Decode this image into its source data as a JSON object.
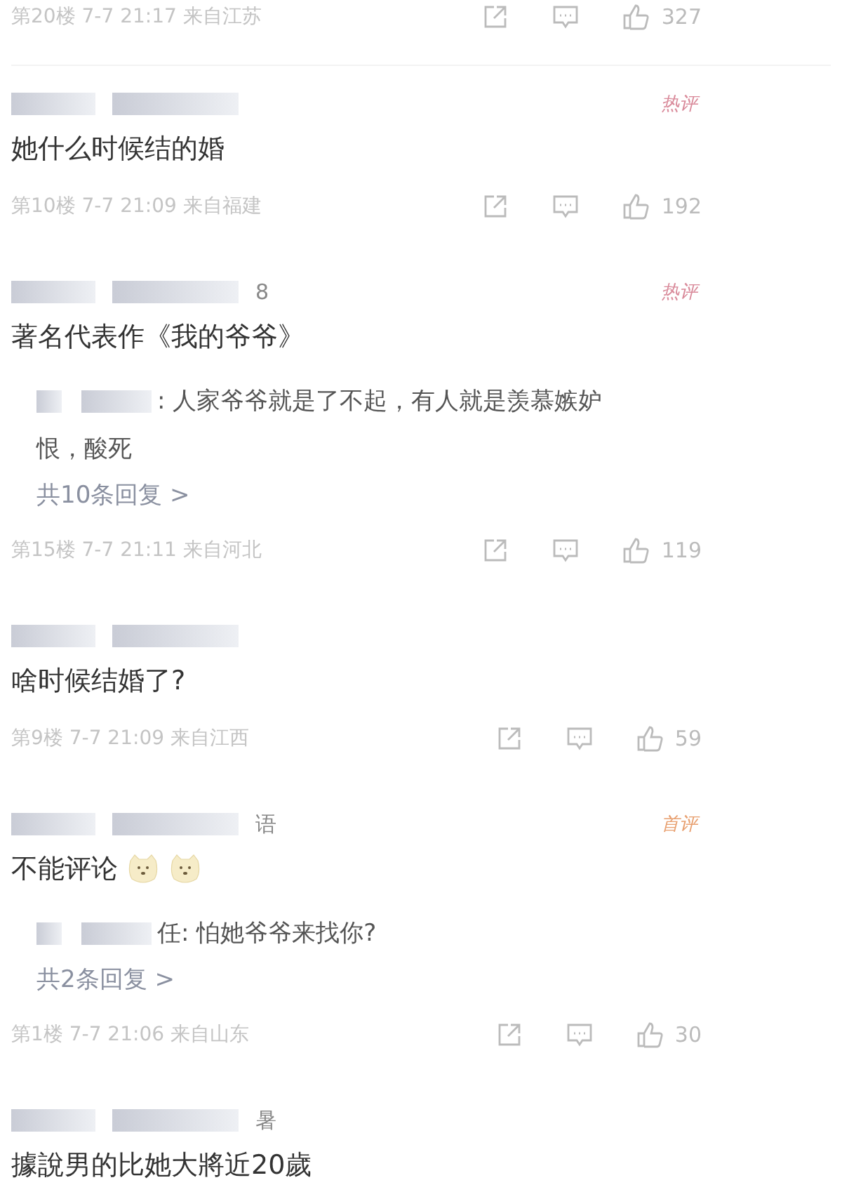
{
  "comments": [
    {
      "meta": {
        "floor": "第20楼",
        "time": "7-7 21:17",
        "location": "来自江苏"
      },
      "likes": "327"
    },
    {
      "badge": {
        "label": "热评",
        "kind": "hot"
      },
      "text": "她什么时候结的婚",
      "meta": {
        "floor": "第10楼",
        "time": "7-7 21:09",
        "location": "来自福建"
      },
      "likes": "192"
    },
    {
      "username": "8",
      "badge": {
        "label": "热评",
        "kind": "hot"
      },
      "text": "著名代表作《我的爷爷》",
      "reply": {
        "text": ": 人家爷爷就是了不起，有人就是羡慕嫉妒恨，酸死",
        "count": "共10条回复 >"
      },
      "meta": {
        "floor": "第15楼",
        "time": "7-7 21:11",
        "location": "来自河北"
      },
      "likes": "119"
    },
    {
      "text": "啥时候结婚了?",
      "meta": {
        "floor": "第9楼",
        "time": "7-7 21:09",
        "location": "来自江西"
      },
      "likes": "59"
    },
    {
      "username": "语",
      "badge": {
        "label": "首评",
        "kind": "first"
      },
      "text": "不能评论",
      "emojis": [
        {
          "kind": "dog"
        },
        {
          "kind": "dog"
        }
      ],
      "reply": {
        "text": "任: 怕她爷爷来找你?",
        "count": "共2条回复 >"
      },
      "meta": {
        "floor": "第1楼",
        "time": "7-7 21:06",
        "location": "来自山东"
      },
      "likes": "30"
    },
    {
      "username": "暑",
      "text": "據說男的比她大將近20歲"
    }
  ]
}
